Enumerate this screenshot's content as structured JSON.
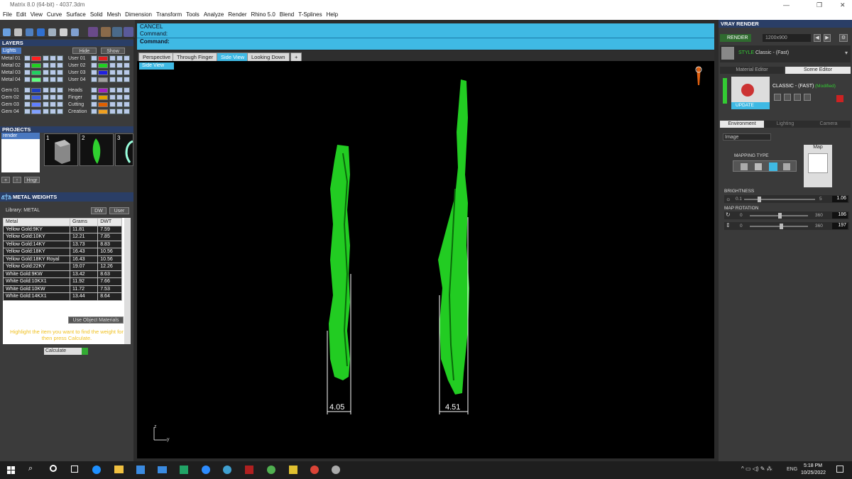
{
  "window": {
    "title": "Matrix 8.0 (64-bit) - 4037.3dm",
    "minimize": "—",
    "restore": "❐",
    "close": "✕"
  },
  "menu": [
    "File",
    "Edit",
    "View",
    "Curve",
    "Surface",
    "Solid",
    "Mesh",
    "Dimension",
    "Transform",
    "Tools",
    "Analyze",
    "Render",
    "Rhino 5.0",
    "Blend",
    "T-Splines",
    "Help"
  ],
  "layers": {
    "title": "LAYERS",
    "lights": "Lights",
    "hide": "Hide",
    "show": "Show",
    "left": [
      {
        "name": "Metal 01",
        "color": "#ff2020"
      },
      {
        "name": "Metal 02",
        "color": "#20d020"
      },
      {
        "name": "Metal 03",
        "color": "#20d060"
      },
      {
        "name": "Metal 04",
        "color": "#60ff80"
      },
      {
        "name": "Gem 01",
        "color": "#2040c0"
      },
      {
        "name": "Gem 02",
        "color": "#4060e0"
      },
      {
        "name": "Gem 03",
        "color": "#6080ff"
      },
      {
        "name": "Gem 04",
        "color": "#80a0ff"
      }
    ],
    "right": [
      {
        "name": "User 01",
        "color": "#e02020"
      },
      {
        "name": "User 02",
        "color": "#20d020"
      },
      {
        "name": "User 03",
        "color": "#2020e0"
      },
      {
        "name": "User 04",
        "color": "#a0a0a0"
      },
      {
        "name": "Heads",
        "color": "#a020c0"
      },
      {
        "name": "Finger",
        "color": "#e0a000"
      },
      {
        "name": "Cutting",
        "color": "#e06000"
      },
      {
        "name": "Creation",
        "color": "#f0a020"
      }
    ]
  },
  "projects": {
    "title": "PROJECTS",
    "item": "render",
    "thumbs": [
      "1",
      "2",
      "3"
    ],
    "hinge": "Hngr"
  },
  "metal_weights": {
    "title": "METAL WEIGHTS",
    "library": "Library: METAL",
    "dw": "DW",
    "user": "User",
    "columns": [
      "Metal",
      "Grams",
      "DWT"
    ],
    "rows": [
      [
        "Yellow Gold:9KY",
        "11.81",
        "7.59"
      ],
      [
        "Yellow Gold:10KY",
        "12.21",
        "7.85"
      ],
      [
        "Yellow Gold:14KY",
        "13.73",
        "8.83"
      ],
      [
        "Yellow Gold:18KY",
        "16.43",
        "10.56"
      ],
      [
        "Yellow Gold:18KY Royal",
        "16.43",
        "10.56"
      ],
      [
        "Yellow Gold:22KY",
        "19.07",
        "12.26"
      ],
      [
        "White Gold:9KW",
        "13.42",
        "8.63"
      ],
      [
        "White Gold:10KX1",
        "11.92",
        "7.66"
      ],
      [
        "White Gold:10KW",
        "11.72",
        "7.53"
      ],
      [
        "White Gold:14KX1",
        "13.44",
        "8.64"
      ]
    ],
    "use_object": "Use Object Materials",
    "hint": "Highlight the item you want to find the weight for then press Calculate.",
    "calculate": "Calculate"
  },
  "command": {
    "line1": "CANCEL",
    "line2": "Command:",
    "line3": "Command:"
  },
  "view_tabs": [
    "Perspective",
    "Through Finger",
    "Side View",
    "Looking Down"
  ],
  "active_tab": "Side View",
  "view_label": "Side View",
  "dimensions": [
    "4.05",
    "4.51"
  ],
  "axis": {
    "z": "z",
    "y": "y"
  },
  "vray": {
    "title": "VRAY RENDER",
    "render": "RENDER",
    "resolution": "1200x900",
    "preset_prefix": "STYLE",
    "preset": "Classic - (Fast)",
    "tabs": [
      "Material Editor",
      "Scene Editor"
    ],
    "scene_title": "CLASSIC - (FAST)",
    "modified": "(Modified)",
    "update": "UPDATE",
    "env_tabs": [
      "Environment",
      "Lighting",
      "Camera"
    ],
    "env_type": "Image",
    "mapping_type": "MAPPING TYPE",
    "map": "Map",
    "brightness": {
      "label": "BRIGHTNESS",
      "min": "0.1",
      "max": "5",
      "value": "1.06",
      "fraction": 0.2
    },
    "map_rotation": {
      "label": "MAP ROTATION"
    },
    "rot1": {
      "min": "0",
      "max": "360",
      "value": "186",
      "fraction": 0.52
    },
    "rot2": {
      "min": "0",
      "max": "360",
      "value": "197",
      "fraction": 0.55
    }
  },
  "taskbar": {
    "time": "5:18 PM",
    "date": "10/25/2022",
    "lang": "ENG"
  }
}
